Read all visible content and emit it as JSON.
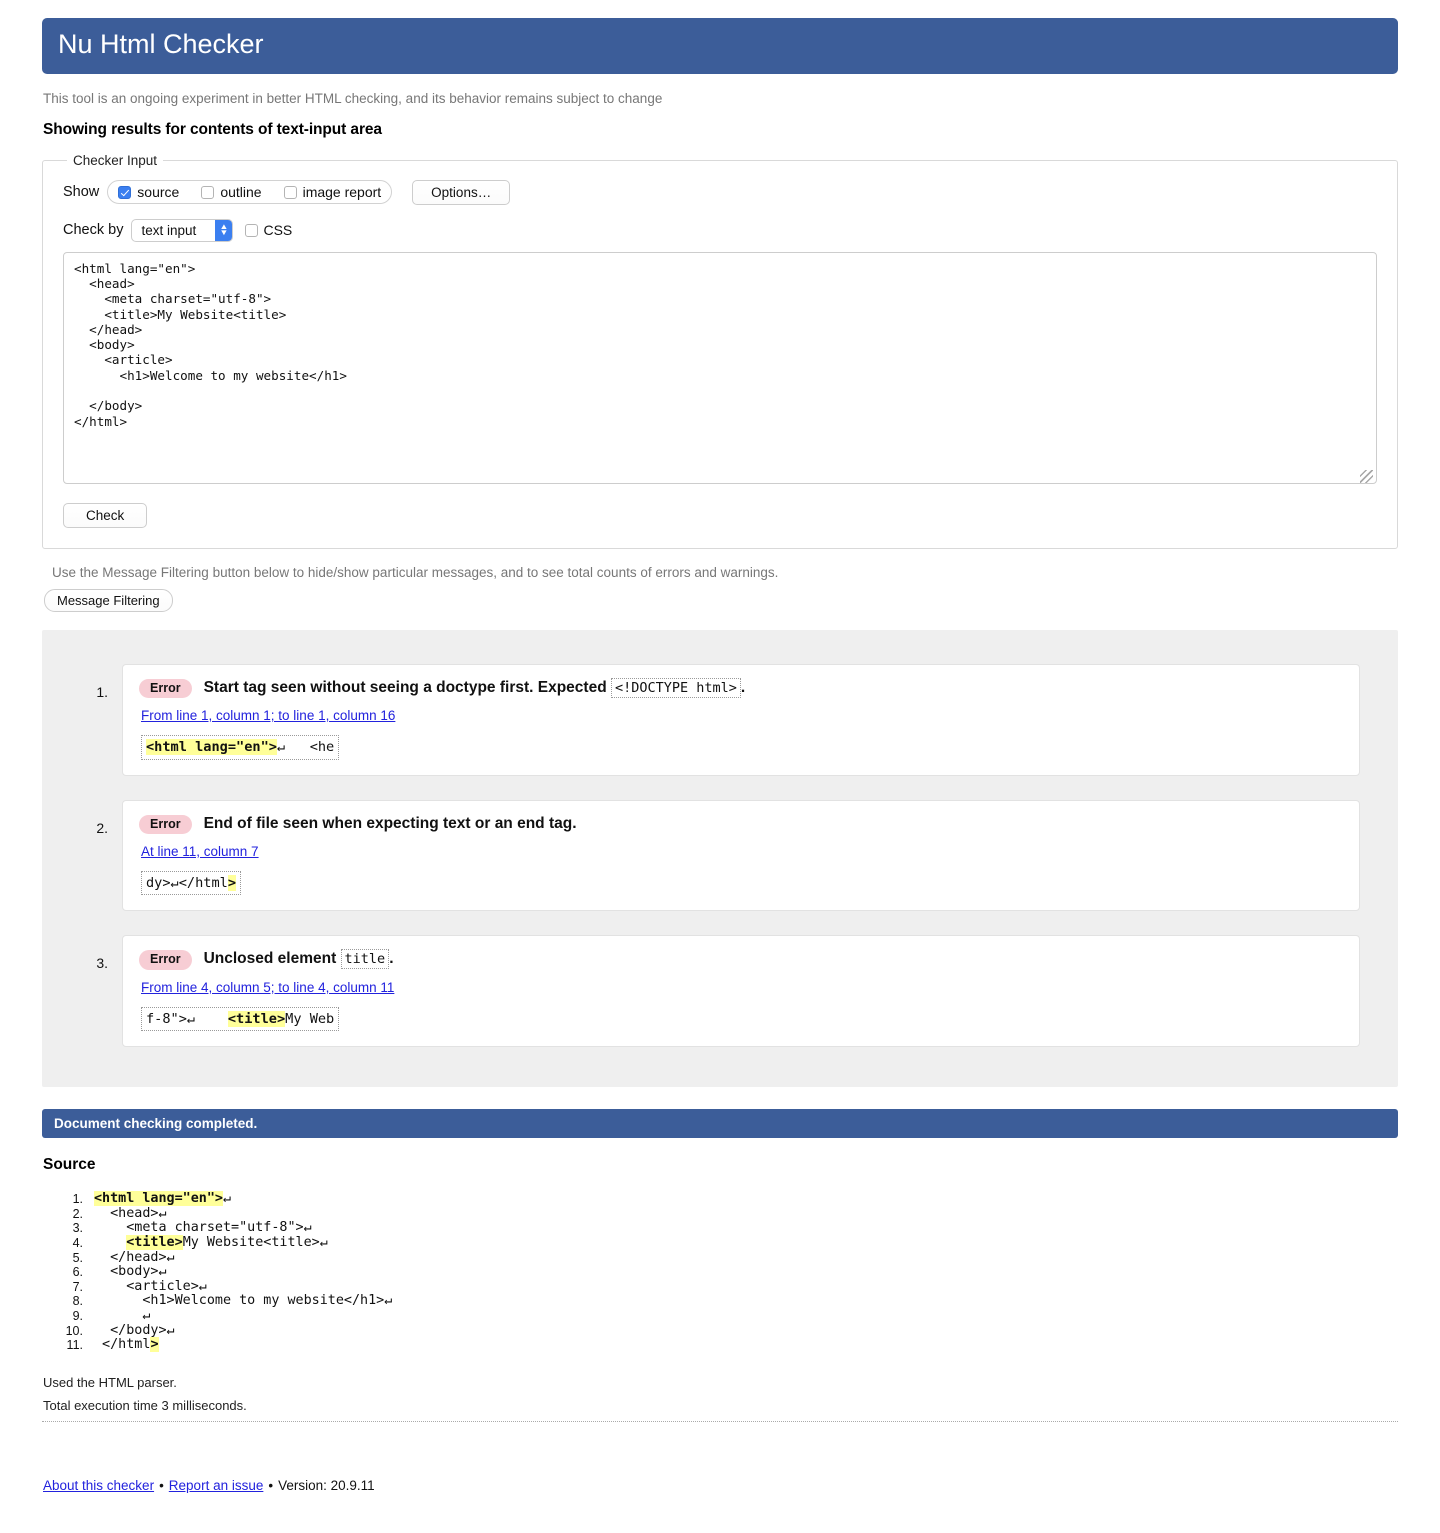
{
  "header": {
    "title": "Nu Html Checker"
  },
  "subtitle": "This tool is an ongoing experiment in better HTML checking, and its behavior remains subject to change",
  "showing_results": "Showing results for contents of text-input area",
  "checker_input": {
    "legend": "Checker Input",
    "show_label": "Show",
    "show_options": [
      {
        "label": "source",
        "checked": true
      },
      {
        "label": "outline",
        "checked": false
      },
      {
        "label": "image report",
        "checked": false
      }
    ],
    "options_button": "Options…",
    "check_by_label": "Check by",
    "check_by_value": "text input",
    "check_by_choices": [
      "text input"
    ],
    "css_label": "CSS",
    "css_checked": false,
    "textarea_value": "<html lang=\"en\">\n  <head>\n    <meta charset=\"utf-8\">\n    <title>My Website<title>\n  </head>\n  <body>\n    <article>\n      <h1>Welcome to my website</h1>\n\n  </body>\n</html>",
    "textarea_placeholder": "",
    "check_button": "Check"
  },
  "filtering": {
    "note": "Use the Message Filtering button below to hide/show particular messages, and to see total counts of errors and warnings.",
    "button": "Message Filtering"
  },
  "messages": [
    {
      "number": "1.",
      "badge": "Error",
      "text_before": "Start tag seen without seeing a doctype first. Expected",
      "code": "<!DOCTYPE html>",
      "text_after": ".",
      "location": "From line 1, column 1; to line 1, column 16",
      "extract_pre": "",
      "extract_hl": "<html lang=\"en\">",
      "extract_post": "↵   <he"
    },
    {
      "number": "2.",
      "badge": "Error",
      "text_before": "End of file seen when expecting text or an end tag.",
      "code": "",
      "text_after": "",
      "location": "At line 11, column 7",
      "extract_pre": "dy>↵</html",
      "extract_hl": ">",
      "extract_post": ""
    },
    {
      "number": "3.",
      "badge": "Error",
      "text_before": "Unclosed element",
      "code": "title",
      "text_after": ".",
      "location": "From line 4, column 5; to line 4, column 11",
      "extract_pre": "f-8\">↵    ",
      "extract_hl": "<title>",
      "extract_post": "My Web"
    }
  ],
  "completion_bar": "Document checking completed.",
  "source_heading": "Source",
  "source_lines": [
    {
      "no": "1.",
      "pre": "",
      "hl": "<html lang=\"en\">",
      "post": "↵"
    },
    {
      "no": "2.",
      "pre": "  <head>↵",
      "hl": "",
      "post": ""
    },
    {
      "no": "3.",
      "pre": "    <meta charset=\"utf-8\">↵",
      "hl": "",
      "post": ""
    },
    {
      "no": "4.",
      "pre": "    ",
      "hl": "<title>",
      "post": "My Website<title>↵"
    },
    {
      "no": "5.",
      "pre": "  </head>↵",
      "hl": "",
      "post": ""
    },
    {
      "no": "6.",
      "pre": "  <body>↵",
      "hl": "",
      "post": ""
    },
    {
      "no": "7.",
      "pre": "    <article>↵",
      "hl": "",
      "post": ""
    },
    {
      "no": "8.",
      "pre": "      <h1>Welcome to my website</h1>↵",
      "hl": "",
      "post": ""
    },
    {
      "no": "9.",
      "pre": "      ↵",
      "hl": "",
      "post": ""
    },
    {
      "no": "10.",
      "pre": "  </body>↵",
      "hl": "",
      "post": ""
    },
    {
      "no": "11.",
      "pre": " </html",
      "hl": ">",
      "post": ""
    }
  ],
  "parser_note": "Used the HTML parser.",
  "execution_note": "Total execution time 3 milliseconds.",
  "footer": {
    "about_link": "About this checker",
    "sep1": "•",
    "report_link": "Report an issue",
    "sep2": "•",
    "version": "Version: 20.9.11"
  },
  "colors": {
    "banner_blue": "#3c5d99",
    "error_badge": "#f7cdd4",
    "highlight_yellow": "#ffff99",
    "link_blue": "#2222dd",
    "results_bg": "#efefef",
    "accent_control": "#3b7ff0"
  }
}
